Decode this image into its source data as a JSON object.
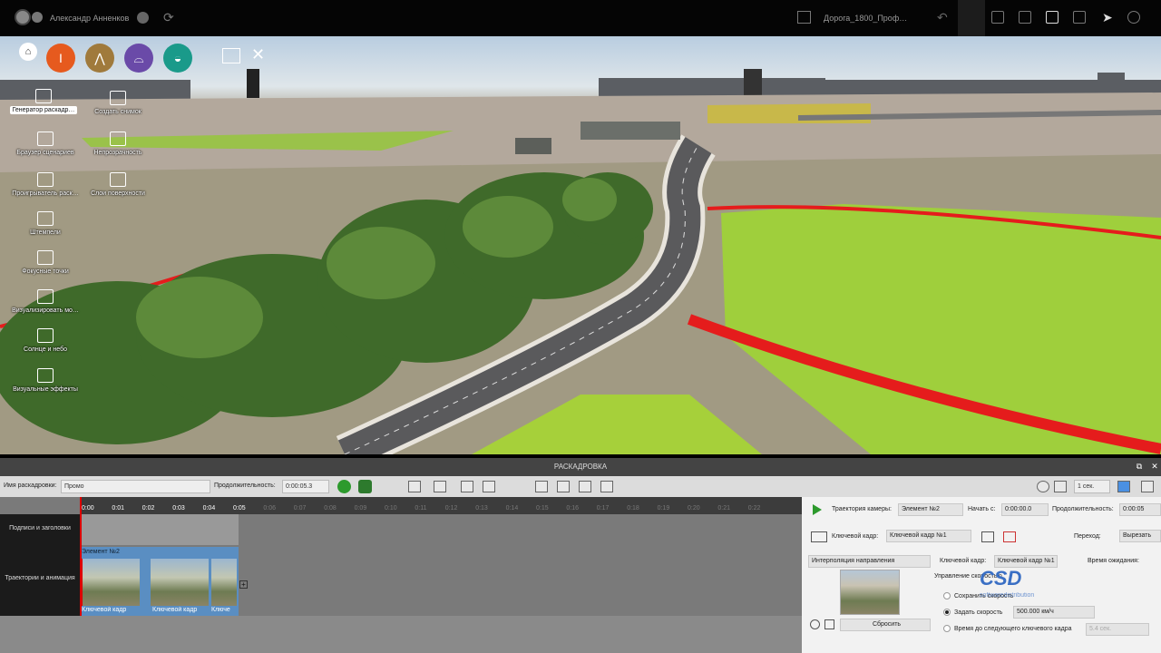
{
  "topbar": {
    "user_name": "Александр Анненков",
    "project_name": "Дорога_1800_Проф…"
  },
  "left_toolbar": {
    "items": [
      {
        "label": "Генератор раскадр…",
        "icon": "storyboard-generator-icon",
        "selected": true
      },
      {
        "label": "Создать снимок",
        "icon": "camera-icon"
      },
      {
        "label": "Браузер сценариев",
        "icon": "scenario-browser-icon"
      },
      {
        "label": "Непрозрачность",
        "icon": "opacity-icon"
      },
      {
        "label": "Проигрыватель раск…",
        "icon": "player-icon"
      },
      {
        "label": "Слои поверхности",
        "icon": "surface-layers-icon"
      },
      {
        "label": "Штемпели",
        "icon": "stamp-icon"
      },
      {
        "label": "Фокусные точки",
        "icon": "focus-points-icon"
      },
      {
        "label": "Визуализировать мо…",
        "icon": "render-model-icon"
      },
      {
        "label": "Солнце и небо",
        "icon": "sun-sky-icon"
      },
      {
        "label": "Визуальные эффекты",
        "icon": "visual-effects-icon"
      }
    ],
    "circles": [
      {
        "icon": "home-icon",
        "color": "#ffffff"
      },
      {
        "icon": "road-icon",
        "color": "#e65a1e"
      },
      {
        "icon": "terrain-icon",
        "color": "#a07a3c"
      },
      {
        "icon": "bridge-icon",
        "color": "#6a4aa8"
      },
      {
        "icon": "water-icon",
        "color": "#1a9a8a"
      }
    ]
  },
  "storyboard": {
    "title": "РАСКАДРОВКА",
    "name_label": "Имя раскадровки:",
    "name_value": "Промо",
    "duration_label": "Продолжительность:",
    "duration_value": "0:00:05.3",
    "time_unit": "1 сек.",
    "ruler_ticks": [
      "0:00",
      "0:01",
      "0:02",
      "0:03",
      "0:04",
      "0:05",
      "0:06",
      "0:07",
      "0:08",
      "0:09",
      "0:10",
      "0:11",
      "0:12",
      "0:13",
      "0:14",
      "0:15",
      "0:16",
      "0:17",
      "0:18",
      "0:19",
      "0:20",
      "0:21",
      "0:22"
    ],
    "tracks": [
      "Подписи и заголовки",
      "Траектории и анимация"
    ],
    "element_label": "Элемент №2",
    "keyframes": [
      "Ключевой кадр",
      "Ключевой кадр",
      "Ключе"
    ]
  },
  "properties": {
    "camera_path_label": "Траектория камеры:",
    "camera_path_value": "Элемент №2",
    "start_label": "Начать с:",
    "start_value": "0:00:00.0",
    "duration_label": "Продолжительность:",
    "duration_value": "0:00:05",
    "keyframe_label": "Ключевой кадр:",
    "keyframe_value": "Ключевой кадр №1",
    "transition_label": "Переход:",
    "transition_value": "Вырезать",
    "interpolation_value": "Интерполяция направления",
    "keyframe2_label": "Ключевой кадр:",
    "keyframe2_value": "Ключевой кадр №1",
    "wait_label": "Время ожидания:",
    "speed_control_label": "Управление скоростью",
    "keep_speed_label": "Сохранить скорость",
    "set_speed_label": "Задать скорость",
    "speed_value": "500.000 км/ч",
    "time_to_next_label": "Время до следующего ключевого кадра",
    "time_to_next_value": "5.4 сек.",
    "reset_label": "Сбросить"
  },
  "watermark": {
    "logo": "CSD",
    "text": "softwaredistribution"
  }
}
